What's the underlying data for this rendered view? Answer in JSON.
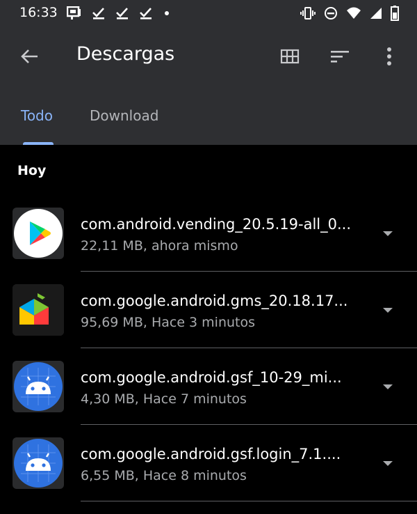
{
  "status_bar": {
    "time": "16:33",
    "left_icons": [
      "notification-icon",
      "check-icon",
      "check-icon",
      "check-icon",
      "dot-icon"
    ],
    "right_icons": [
      "vibrate-icon",
      "do-not-disturb-icon",
      "wifi-icon",
      "signal-icon",
      "battery-icon"
    ]
  },
  "app_bar": {
    "title": "Descargas",
    "icons": [
      "back-arrow-icon",
      "grid-view-icon",
      "sort-icon",
      "more-vert-icon"
    ]
  },
  "tabs": [
    {
      "label": "Todo",
      "selected": true
    },
    {
      "label": "Download",
      "selected": false
    }
  ],
  "section": {
    "header": "Hoy"
  },
  "files": [
    {
      "name": "com.android.vending_20.5.19-all_0...",
      "meta": "22,11 MB, ahora mismo",
      "icon": "play-store-icon"
    },
    {
      "name": "com.google.android.gms_20.18.17...",
      "meta": "95,69 MB, Hace 3 minutos",
      "icon": "play-services-icon"
    },
    {
      "name": "com.google.android.gsf_10-29_mi...",
      "meta": "4,30 MB, Hace 7 minutos",
      "icon": "android-icon"
    },
    {
      "name": "com.google.android.gsf.login_7.1....",
      "meta": "6,55 MB, Hace 8 minutos",
      "icon": "android-icon"
    }
  ],
  "colors": {
    "app_bar_bg": "#2e2f32",
    "accent": "#8ab4f8",
    "background": "#000000",
    "secondary_text": "#a9abae"
  }
}
